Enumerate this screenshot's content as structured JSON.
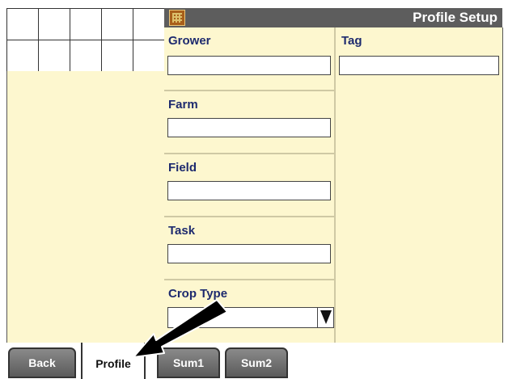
{
  "screen": {
    "title": "Profile Setup",
    "app_icon": "field-map-icon"
  },
  "fields": {
    "grower": {
      "label": "Grower",
      "value": ""
    },
    "tag": {
      "label": "Tag",
      "value": ""
    },
    "farm": {
      "label": "Farm",
      "value": ""
    },
    "field": {
      "label": "Field",
      "value": ""
    },
    "task": {
      "label": "Task",
      "value": ""
    },
    "crop_type": {
      "label": "Crop Type",
      "value": ""
    }
  },
  "tabs": [
    {
      "label": "Back",
      "active": false
    },
    {
      "label": "Profile",
      "active": true
    },
    {
      "label": "Sum1",
      "active": false
    },
    {
      "label": "Sum2",
      "active": false
    }
  ],
  "colors": {
    "panel_bg": "#fdf7cf",
    "title_bar": "#5d5d5d",
    "label_text": "#1d2a6e"
  },
  "annotation": {
    "icon": "pointer-arrow-icon"
  }
}
